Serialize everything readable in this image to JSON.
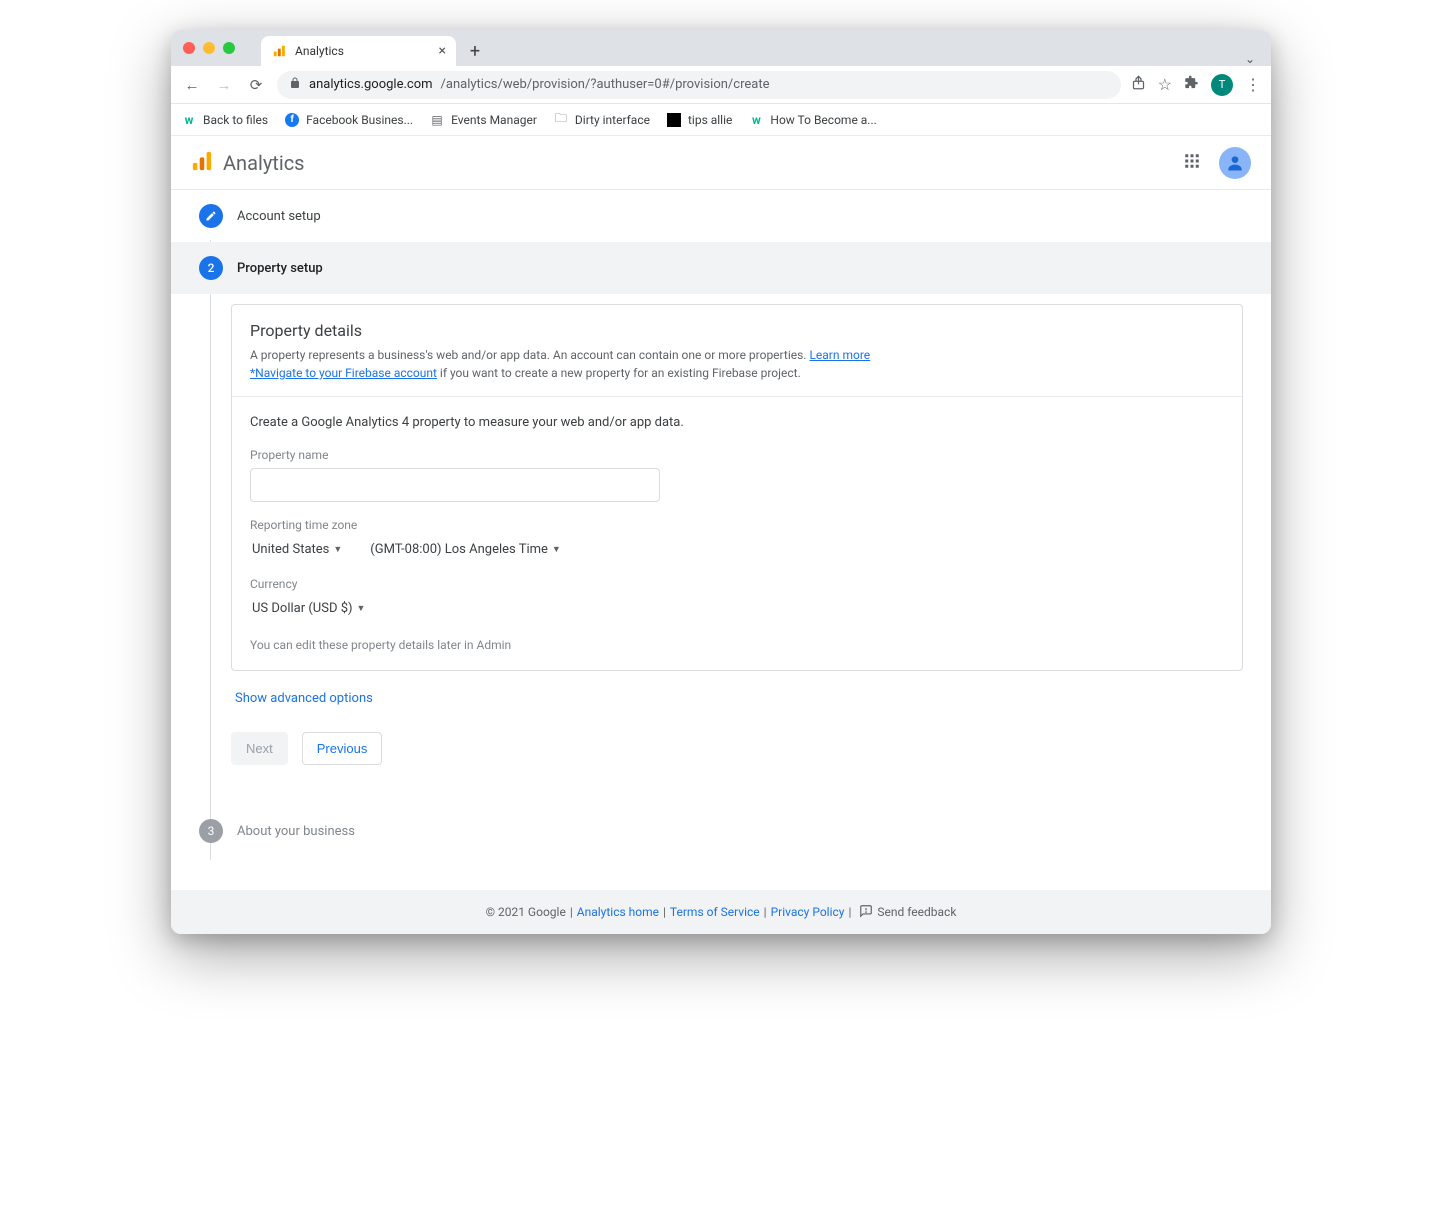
{
  "browser": {
    "tab_title": "Analytics",
    "url_domain": "analytics.google.com",
    "url_path": "/analytics/web/provision/?authuser=0#/provision/create",
    "avatar_initial": "T"
  },
  "bookmarks": [
    {
      "label": "Back to files"
    },
    {
      "label": "Facebook Busines..."
    },
    {
      "label": "Events Manager"
    },
    {
      "label": "Dirty interface"
    },
    {
      "label": "tips allie"
    },
    {
      "label": "How To Become a..."
    }
  ],
  "app": {
    "title": "Analytics"
  },
  "steps": {
    "s1": "Account setup",
    "s2": "Property setup",
    "s2_num": "2",
    "s3": "About your business",
    "s3_num": "3"
  },
  "panel": {
    "title": "Property details",
    "desc1": "A property represents a business's web and/or app data. An account can contain one or more properties. ",
    "learn_more": "Learn more",
    "firebase_link": "*Navigate to your Firebase account",
    "desc2": " if you want to create a new property for an existing Firebase project.",
    "lead": "Create a Google Analytics 4 property to measure your web and/or app data.",
    "property_name_label": "Property name",
    "property_name_value": "",
    "timezone_label": "Reporting time zone",
    "country": "United States",
    "tz": "(GMT-08:00) Los Angeles Time",
    "currency_label": "Currency",
    "currency": "US Dollar (USD $)",
    "hint": "You can edit these property details later in Admin"
  },
  "advanced": "Show advanced options",
  "buttons": {
    "next": "Next",
    "previous": "Previous"
  },
  "footer": {
    "copyright": "© 2021 Google",
    "sep": " | ",
    "analytics_home": "Analytics home",
    "tos": "Terms of Service",
    "privacy": "Privacy Policy",
    "feedback": "Send feedback"
  }
}
